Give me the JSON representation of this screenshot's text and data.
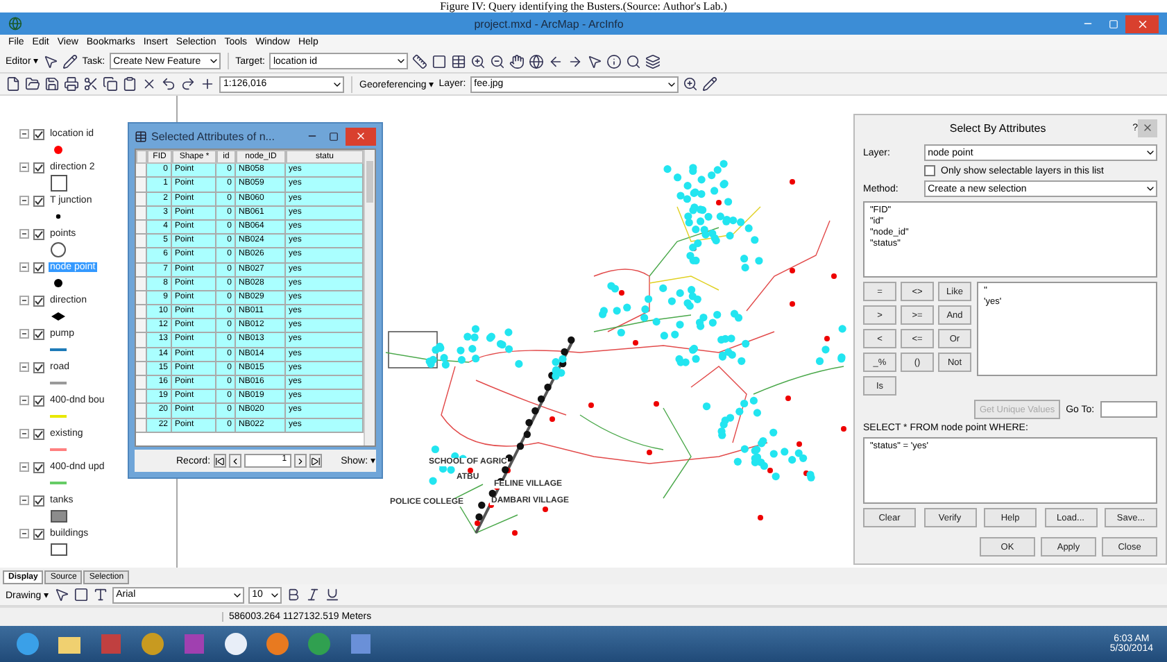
{
  "caption": "Figure IV: Query identifying the Busters.(Source: Author's Lab.)",
  "window": {
    "title": "project.mxd - ArcMap - ArcInfo"
  },
  "menu": [
    "File",
    "Edit",
    "View",
    "Bookmarks",
    "Insert",
    "Selection",
    "Tools",
    "Window",
    "Help"
  ],
  "editor_toolbar": {
    "editor": "Editor ▾",
    "task_label": "Task:",
    "task": "Create New Feature",
    "target_label": "Target:",
    "target": "location id"
  },
  "standard_toolbar": {
    "scale": "1:126,016",
    "georeferencing": "Georeferencing ▾",
    "layer_label": "Layer:",
    "layer": "fee.jpg"
  },
  "toc": {
    "layers": [
      {
        "name": "location id",
        "checked": true,
        "selected": false,
        "kind": "dot",
        "color": "#ff0000"
      },
      {
        "name": "direction 2",
        "checked": true,
        "selected": false,
        "kind": "square",
        "color": "#ffffff"
      },
      {
        "name": "T junction",
        "checked": true,
        "selected": false,
        "kind": "small-dot",
        "color": "#000000"
      },
      {
        "name": "points",
        "checked": true,
        "selected": false,
        "kind": "circle",
        "color": "#ffffff"
      },
      {
        "name": "node point",
        "checked": true,
        "selected": true,
        "kind": "dot",
        "color": "#000000"
      },
      {
        "name": "direction",
        "checked": true,
        "selected": false,
        "kind": "diamond",
        "color": "#000000"
      },
      {
        "name": "pump",
        "checked": true,
        "selected": false,
        "kind": "line",
        "color": "#1e7bb8"
      },
      {
        "name": "road",
        "checked": true,
        "selected": false,
        "kind": "line",
        "color": "#9a9a9a"
      },
      {
        "name": "400-dnd bou",
        "checked": true,
        "selected": false,
        "kind": "line",
        "color": "#e8e800"
      },
      {
        "name": "existing",
        "checked": true,
        "selected": false,
        "kind": "line",
        "color": "#ff8080"
      },
      {
        "name": "400-dnd upd",
        "checked": true,
        "selected": false,
        "kind": "line",
        "color": "#66cc66"
      },
      {
        "name": "tanks",
        "checked": true,
        "selected": false,
        "kind": "fill",
        "color": "#8c8c8c"
      },
      {
        "name": "buildings",
        "checked": true,
        "selected": false,
        "kind": "fill",
        "color": "#ffffff"
      }
    ],
    "tabs": [
      {
        "label": "Display",
        "selected": true
      },
      {
        "label": "Source",
        "selected": false
      },
      {
        "label": "Selection",
        "selected": false
      }
    ]
  },
  "attribute_table": {
    "title": "Selected Attributes of n...",
    "columns": [
      "FID",
      "Shape *",
      "id",
      "node_ID",
      "statu"
    ],
    "rows": [
      [
        "0",
        "Point",
        "0",
        "NB058",
        "yes"
      ],
      [
        "1",
        "Point",
        "0",
        "NB059",
        "yes"
      ],
      [
        "2",
        "Point",
        "0",
        "NB060",
        "yes"
      ],
      [
        "3",
        "Point",
        "0",
        "NB061",
        "yes"
      ],
      [
        "4",
        "Point",
        "0",
        "NB064",
        "yes"
      ],
      [
        "5",
        "Point",
        "0",
        "NB024",
        "yes"
      ],
      [
        "6",
        "Point",
        "0",
        "NB026",
        "yes"
      ],
      [
        "7",
        "Point",
        "0",
        "NB027",
        "yes"
      ],
      [
        "8",
        "Point",
        "0",
        "NB028",
        "yes"
      ],
      [
        "9",
        "Point",
        "0",
        "NB029",
        "yes"
      ],
      [
        "10",
        "Point",
        "0",
        "NB011",
        "yes"
      ],
      [
        "12",
        "Point",
        "0",
        "NB012",
        "yes"
      ],
      [
        "13",
        "Point",
        "0",
        "NB013",
        "yes"
      ],
      [
        "14",
        "Point",
        "0",
        "NB014",
        "yes"
      ],
      [
        "15",
        "Point",
        "0",
        "NB015",
        "yes"
      ],
      [
        "16",
        "Point",
        "0",
        "NB016",
        "yes"
      ],
      [
        "19",
        "Point",
        "0",
        "NB019",
        "yes"
      ],
      [
        "20",
        "Point",
        "0",
        "NB020",
        "yes"
      ],
      [
        "22",
        "Point",
        "0",
        "NB022",
        "yes"
      ]
    ],
    "record_label": "Record:",
    "record": "1",
    "show_label": "Show: ▾"
  },
  "map": {
    "labels": [
      "SCHOOL OF AGRIC",
      "ATBU",
      "FELINE VILLAGE",
      "POLICE COLLEGE",
      "DAMBARI VILLAGE"
    ]
  },
  "select_dialog": {
    "title": "Select By Attributes",
    "help": "?",
    "layer_label": "Layer:",
    "layer": "node point",
    "only_selectable": {
      "label": "Only show selectable layers in this list",
      "checked": false
    },
    "method_label": "Method:",
    "method": "Create a new selection",
    "fields": [
      "\"FID\"",
      "\"id\"",
      "\"node_id\"",
      "\"status\""
    ],
    "operators": [
      "=",
      "<>",
      "Like",
      ">",
      ">=",
      "And",
      "<",
      "<=",
      "Or",
      "_%",
      "()",
      "Not",
      "Is"
    ],
    "values": [
      "''",
      "'yes'"
    ],
    "unique_button": "Get Unique Values",
    "goto_label": "Go To:",
    "where_label": "SELECT * FROM node point WHERE:",
    "expression": "\"status\" = 'yes'",
    "tool_buttons": [
      "Clear",
      "Verify",
      "Help",
      "Load...",
      "Save..."
    ],
    "buttons": [
      "OK",
      "Apply",
      "Close"
    ]
  },
  "drawing_toolbar": {
    "drawing": "Drawing ▾",
    "font": "Arial",
    "size": "10"
  },
  "status_bar": {
    "coordinates": "586003.264  1127132.519 Meters"
  },
  "taskbar": {
    "time": "6:03 AM",
    "date": "5/30/2014"
  }
}
